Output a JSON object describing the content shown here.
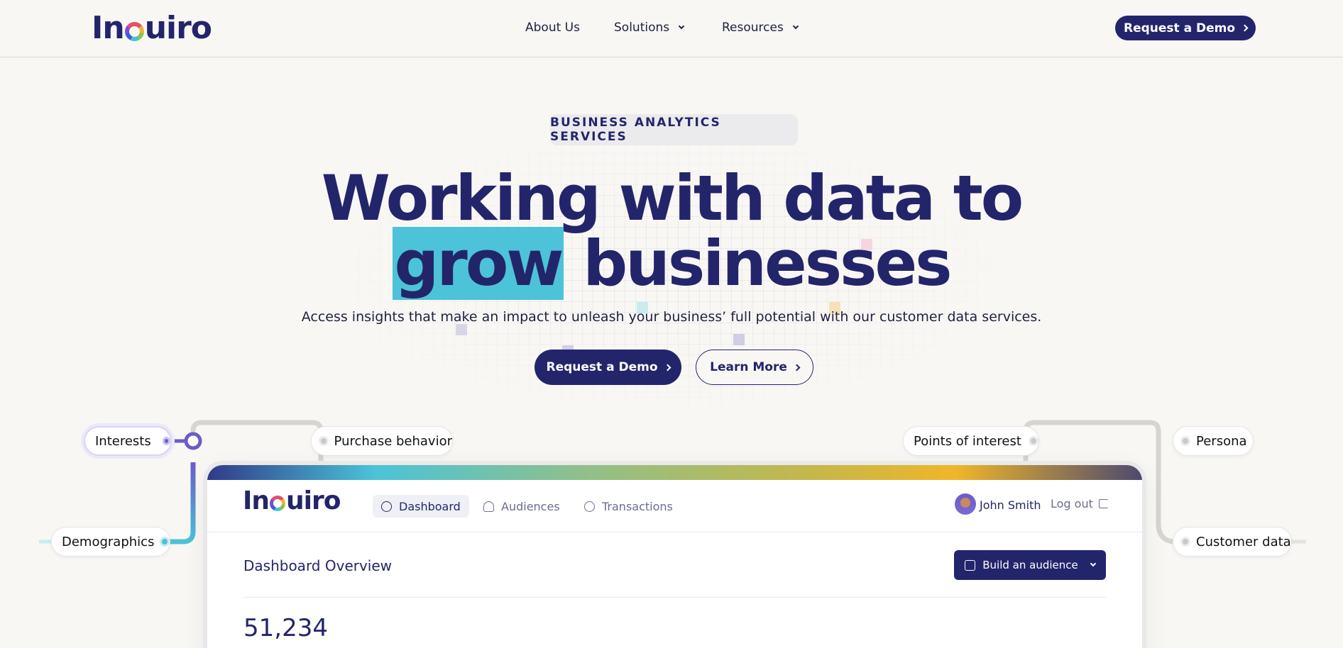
{
  "header": {
    "logo": {
      "pre": "In",
      "post": "uiro"
    },
    "nav": [
      {
        "label": "About Us"
      },
      {
        "label": "Solutions"
      },
      {
        "label": "Resources"
      }
    ],
    "cta": "Request a Demo"
  },
  "hero": {
    "badge": "BUSINESS ANALYTICS SERVICES",
    "title_line1": "Working with data to",
    "title_highlight": "grow",
    "title_rest": " businesses",
    "subtitle": "Access insights that make an impact to unleash your business’ full potential with our customer data services.",
    "primary_cta": "Request a Demo",
    "secondary_cta": "Learn More"
  },
  "tags": {
    "interests": "Interests",
    "purchase": "Purchase behavior",
    "demographics": "Demographics",
    "points": "Points of interest",
    "persona": "Persona",
    "customer": "Customer data"
  },
  "dashboard": {
    "logo": {
      "pre": "In",
      "post": "uiro"
    },
    "tabs": [
      {
        "label": "Dashboard"
      },
      {
        "label": "Audiences"
      },
      {
        "label": "Transactions"
      }
    ],
    "user_name": "John Smith",
    "logout": "Log out",
    "overview_title": "Dashboard Overview",
    "build_button": "Build an audience",
    "metric_value": "51,234"
  },
  "colors": {
    "brand": "#23256b",
    "accent": "#4cc3d8",
    "background": "#f8f7f4"
  }
}
